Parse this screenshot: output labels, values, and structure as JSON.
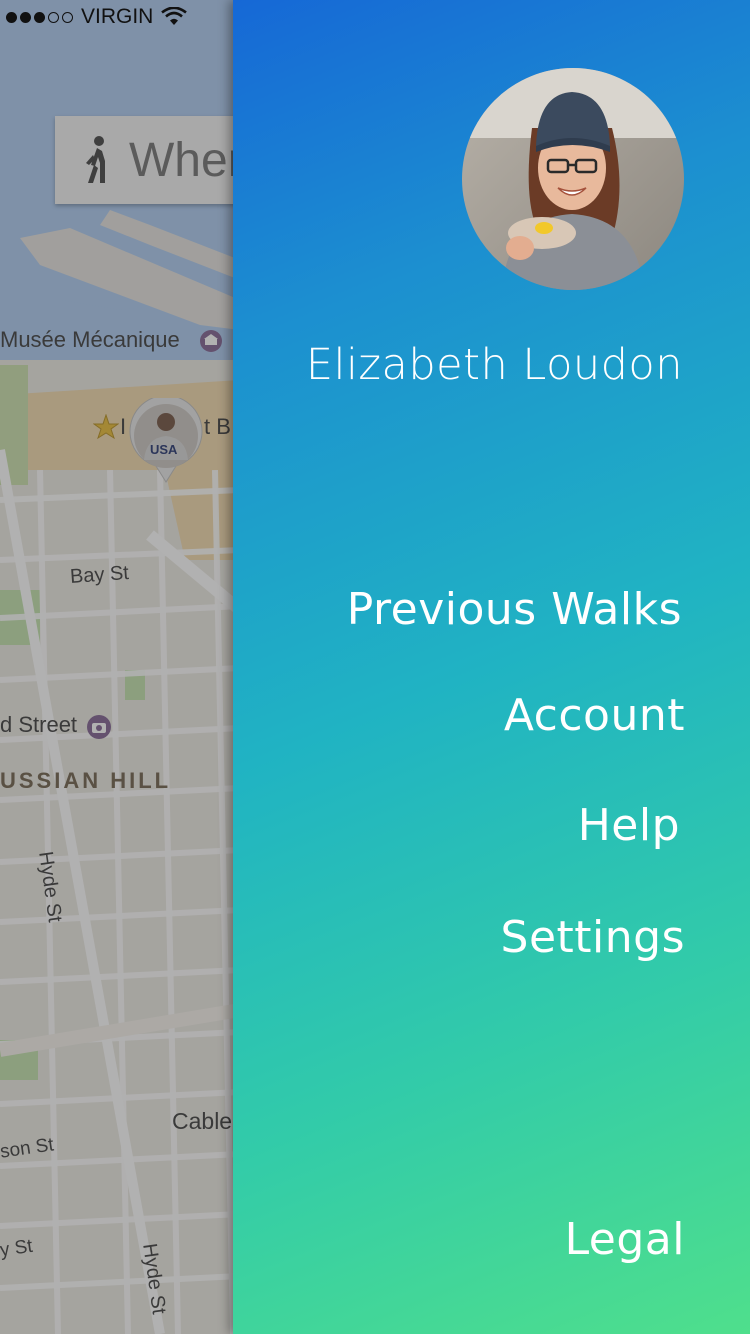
{
  "status_bar": {
    "carrier": "VIRGIN",
    "signal_strength": 3,
    "signal_max": 5
  },
  "search": {
    "text": "Wher"
  },
  "map": {
    "labels": {
      "musee": "Musée Mécanique",
      "landmark_fragment_1": "I",
      "landmark_fragment_2": "t B",
      "bay_st": "Bay St",
      "street_fragment": "d Street",
      "russian_hill": "USSIAN HILL",
      "hyde_st_1": "Hyde St",
      "cable": "Cable",
      "son_st": "son St",
      "y_st": "y St",
      "hyde_st_2": "Hyde St"
    },
    "pin_shirt_text": "USA"
  },
  "drawer": {
    "user_name": "Elizabeth Loudon",
    "menu": {
      "previous_walks": "Previous Walks",
      "account": "Account",
      "help": "Help",
      "settings": "Settings",
      "legal": "Legal"
    }
  },
  "colors": {
    "gradient_top": "#1668d6",
    "gradient_bottom": "#4fdf8c",
    "menu_text": "#ffffff"
  }
}
